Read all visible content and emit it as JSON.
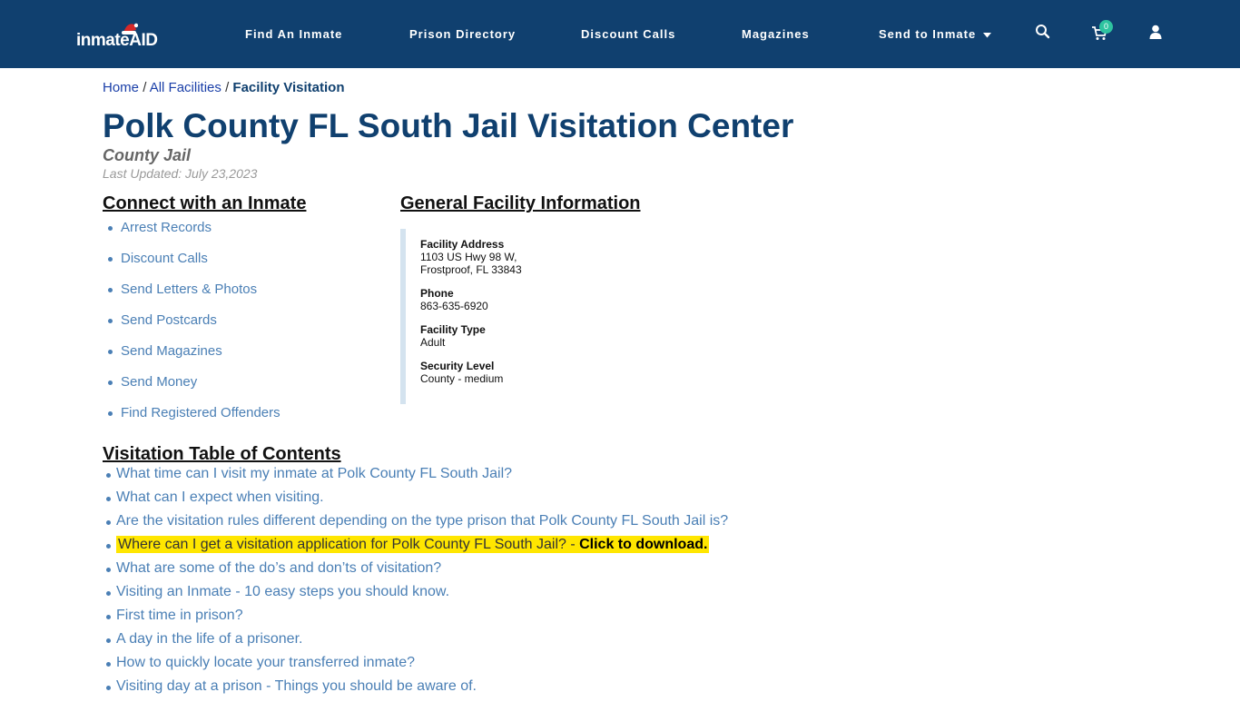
{
  "header": {
    "logo_text": "inmateAID",
    "nav": [
      "Find An Inmate",
      "Prison Directory",
      "Discount Calls",
      "Magazines",
      "Send to Inmate"
    ],
    "cart_count": "0",
    "icons": [
      "search-icon",
      "cart-icon",
      "user-icon",
      "caret-down-icon"
    ]
  },
  "breadcrumb": {
    "home": "Home",
    "all": "All Facilities",
    "current": "Facility Visitation",
    "sep": "/"
  },
  "page": {
    "title": "Polk County FL South Jail Visitation Center",
    "subtitle": "County Jail",
    "updated": "Last Updated: July 23,2023"
  },
  "connect": {
    "heading": "Connect with an Inmate",
    "items": [
      "Arrest Records",
      "Discount Calls",
      "Send Letters & Photos",
      "Send Postcards",
      "Send Magazines",
      "Send Money",
      "Find Registered Offenders"
    ]
  },
  "facility": {
    "heading": "General Facility Information",
    "address_label": "Facility Address",
    "address_line1": "1103 US Hwy 98 W,",
    "address_line2": "Frostproof, FL 33843",
    "phone_label": "Phone",
    "phone": "863-635-6920",
    "type_label": "Facility Type",
    "type": "Adult",
    "security_label": "Security Level",
    "security": "County - medium"
  },
  "toc": {
    "heading": "Visitation Table of Contents",
    "items": [
      "What time can I visit my inmate at Polk County FL South Jail?",
      "What can I expect when visiting.",
      "Are the visitation rules different depending on the type prison that Polk County FL South Jail is?",
      "Where can I get a visitation application for Polk County FL South Jail? - ",
      "What are some of the do’s and don’ts of visitation?",
      "Visiting an Inmate - 10 easy steps you should know.",
      "First time in prison?",
      "A day in the life of a prisoner.",
      "How to quickly locate your transferred inmate?",
      "Visiting day at a prison - Things you should be aware of."
    ],
    "download_label": "Click to download.",
    "highlight_color": "#ffe600"
  },
  "colors": {
    "nav_bg": "#10406f",
    "title": "#10406f",
    "link": "#4a7fb5",
    "badge": "#2ec4a0"
  }
}
